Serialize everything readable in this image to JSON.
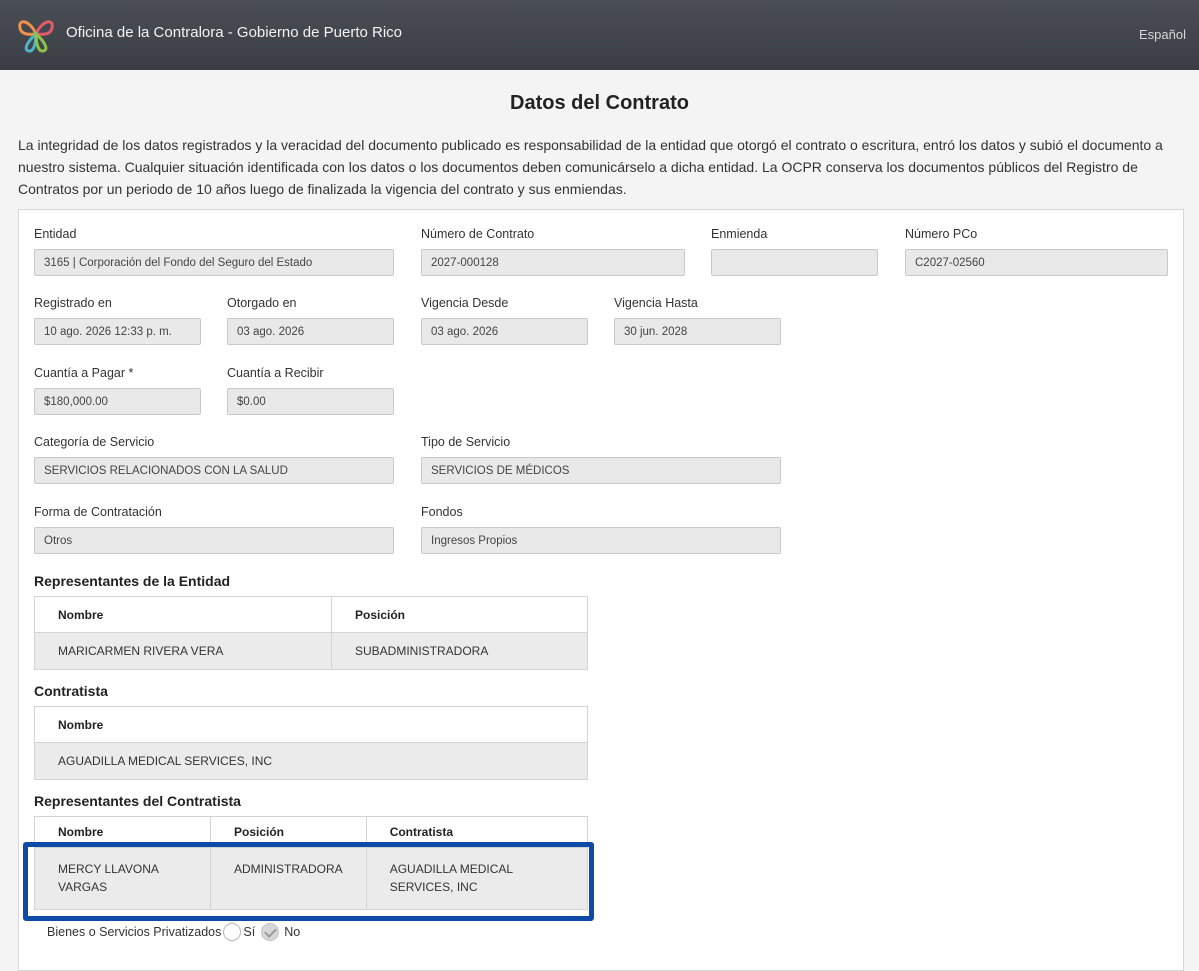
{
  "header": {
    "app_title": "Oficina de la Contralora - Gobierno de Puerto Rico",
    "language": "Español",
    "logo_icon": "butterfly-logo-icon"
  },
  "page": {
    "title": "Datos del Contrato",
    "intro": "La integridad de los datos registrados y la veracidad del documento publicado es responsabilidad de la entidad que otorgó el contrato o escritura, entró los datos y subió el documento a nuestro sistema. Cualquier situación identificada con los datos o los documentos deben comunicárselo a dicha entidad. La OCPR conserva los documentos públicos del Registro de Contratos por un periodo de 10 años luego de finalizada la vigencia del contrato y sus enmiendas."
  },
  "fields": {
    "entidad": {
      "label": "Entidad",
      "value": "3165 | Corporación del Fondo del Seguro del Estado"
    },
    "numero_contrato": {
      "label": "Número de Contrato",
      "value": "2027-000128"
    },
    "enmienda": {
      "label": "Enmienda",
      "value": ""
    },
    "numero_pco": {
      "label": "Número PCo",
      "value": "C2027-02560"
    },
    "registrado_en": {
      "label": "Registrado en",
      "value": "10 ago. 2026 12:33 p. m."
    },
    "otorgado_en": {
      "label": "Otorgado en",
      "value": "03 ago. 2026"
    },
    "vigencia_desde": {
      "label": "Vigencia Desde",
      "value": "03 ago. 2026"
    },
    "vigencia_hasta": {
      "label": "Vigencia Hasta",
      "value": "30 jun. 2028"
    },
    "cuantia_pagar": {
      "label": "Cuantía a Pagar *",
      "value": "$180,000.00"
    },
    "cuantia_recibir": {
      "label": "Cuantía a Recibir",
      "value": "$0.00"
    },
    "categoria_servicio": {
      "label": "Categoría de Servicio",
      "value": "SERVICIOS RELACIONADOS CON LA SALUD"
    },
    "tipo_servicio": {
      "label": "Tipo de Servicio",
      "value": "SERVICIOS DE MÉDICOS"
    },
    "forma_contratacion": {
      "label": "Forma de Contratación",
      "value": "Otros"
    },
    "fondos": {
      "label": "Fondos",
      "value": "Ingresos Propios"
    }
  },
  "representantes_entidad": {
    "title": "Representantes de la Entidad",
    "headers": [
      "Nombre",
      "Posición"
    ],
    "rows": [
      [
        "MARICARMEN RIVERA VERA",
        "SUBADMINISTRADORA"
      ]
    ]
  },
  "contratista": {
    "title": "Contratista",
    "headers": [
      "Nombre"
    ],
    "rows": [
      [
        "AGUADILLA MEDICAL SERVICES, INC"
      ]
    ]
  },
  "representantes_contratista": {
    "title": "Representantes del Contratista",
    "headers": [
      "Nombre",
      "Posición",
      "Contratista"
    ],
    "rows": [
      [
        "MERCY LLAVONA VARGAS",
        "ADMINISTRADORA",
        "AGUADILLA MEDICAL SERVICES, INC"
      ]
    ]
  },
  "privatizados": {
    "label": "Bienes o Servicios Privatizados",
    "options": [
      "Sí",
      "No"
    ],
    "selected": "No"
  },
  "colors": {
    "header_bg": "#3f4349",
    "highlight": "#0e4aa8"
  }
}
